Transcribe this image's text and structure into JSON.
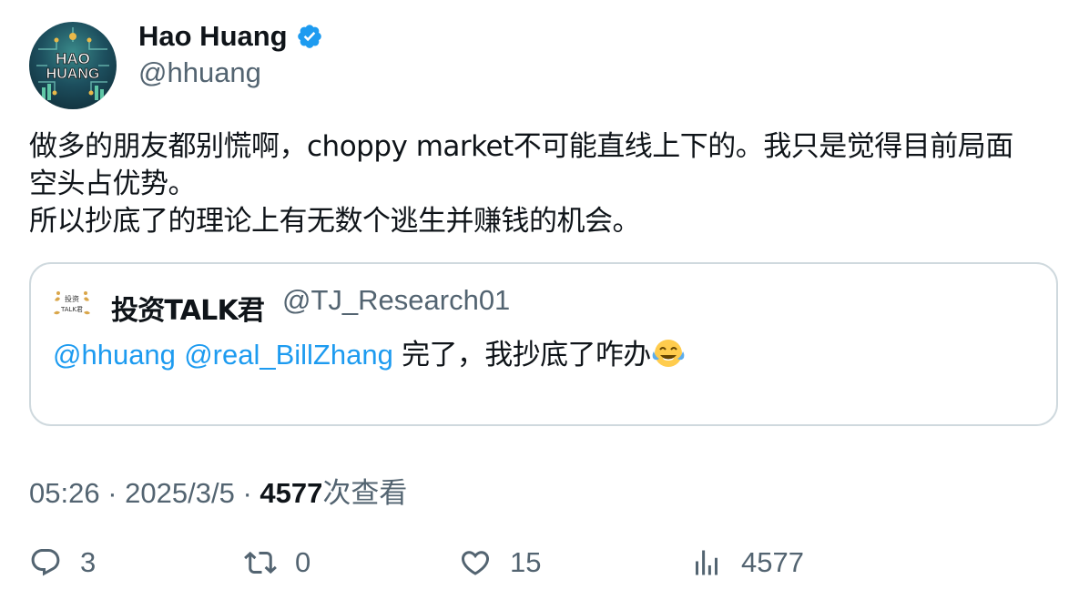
{
  "author": {
    "name": "Hao Huang",
    "handle": "@hhuang",
    "avatar_text": [
      "HAO",
      "HUANG"
    ],
    "verified": true
  },
  "tweet": {
    "lines": [
      "做多的朋友都别慌啊，choppy market不可能直线上下的。我只是觉得目前局面",
      "空头占优势。",
      "所以抄底了的理论上有无数个逃生并赚钱的机会。"
    ]
  },
  "quote": {
    "avatar_text": [
      "投资",
      "TALK君"
    ],
    "name": "投资TALK君",
    "handle": "@TJ_Research01",
    "mentions": [
      "@hhuang",
      "@real_BillZhang"
    ],
    "text": "完了，我抄底了咋办",
    "emoji": "face-with-tears-of-joy"
  },
  "meta": {
    "time": "05:26",
    "separator": "·",
    "date": "2025/3/5",
    "views_count": "4577",
    "views_label": "次查看"
  },
  "actions": {
    "replies": "3",
    "retweets": "0",
    "likes": "15",
    "views": "4577"
  },
  "colors": {
    "link": "#1d9bf0",
    "secondary": "#536471",
    "primary": "#0f1419",
    "border": "#cfd9de"
  }
}
